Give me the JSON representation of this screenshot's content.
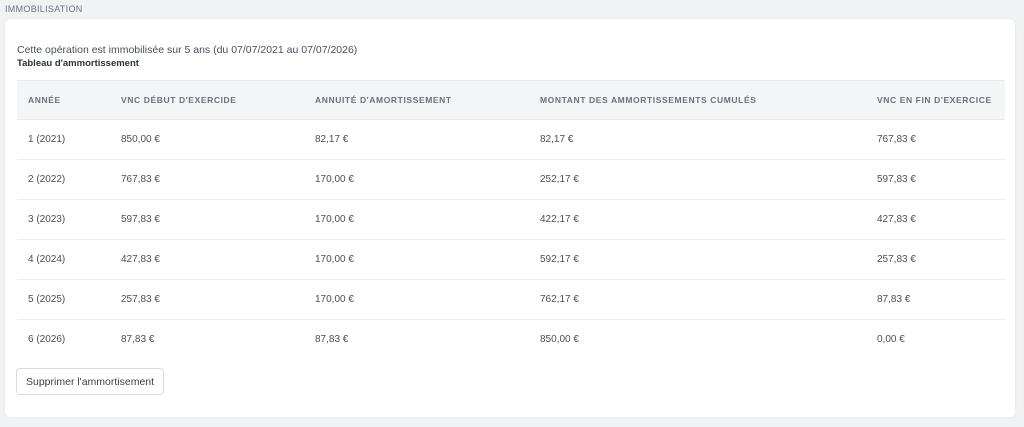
{
  "section": {
    "title": "IMMOBILISATION"
  },
  "card": {
    "intro": "Cette opération est immobilisée sur 5 ans (du 07/07/2021 au 07/07/2026)",
    "subtitle": "Tableau d'ammortissement"
  },
  "table": {
    "headers": [
      "ANNÉE",
      "VNC DÉBUT D'EXERCIDE",
      "ANNUITÉ D'AMORTISSEMENT",
      "MONTANT DES AMMORTISSEMENTS CUMULÉS",
      "VNC EN FIN D'EXERCICE"
    ],
    "rows": [
      [
        "1 (2021)",
        "850,00 €",
        "82,17 €",
        "82,17 €",
        "767,83 €"
      ],
      [
        "2 (2022)",
        "767,83 €",
        "170,00 €",
        "252,17 €",
        "597,83 €"
      ],
      [
        "3 (2023)",
        "597,83 €",
        "170,00 €",
        "422,17 €",
        "427,83 €"
      ],
      [
        "4 (2024)",
        "427,83 €",
        "170,00 €",
        "592,17 €",
        "257,83 €"
      ],
      [
        "5 (2025)",
        "257,83 €",
        "170,00 €",
        "762,17 €",
        "87,83 €"
      ],
      [
        "6 (2026)",
        "87,83 €",
        "87,83 €",
        "850,00 €",
        "0,00 €"
      ]
    ]
  },
  "actions": {
    "delete_label": "Supprimer l'ammortisement"
  }
}
